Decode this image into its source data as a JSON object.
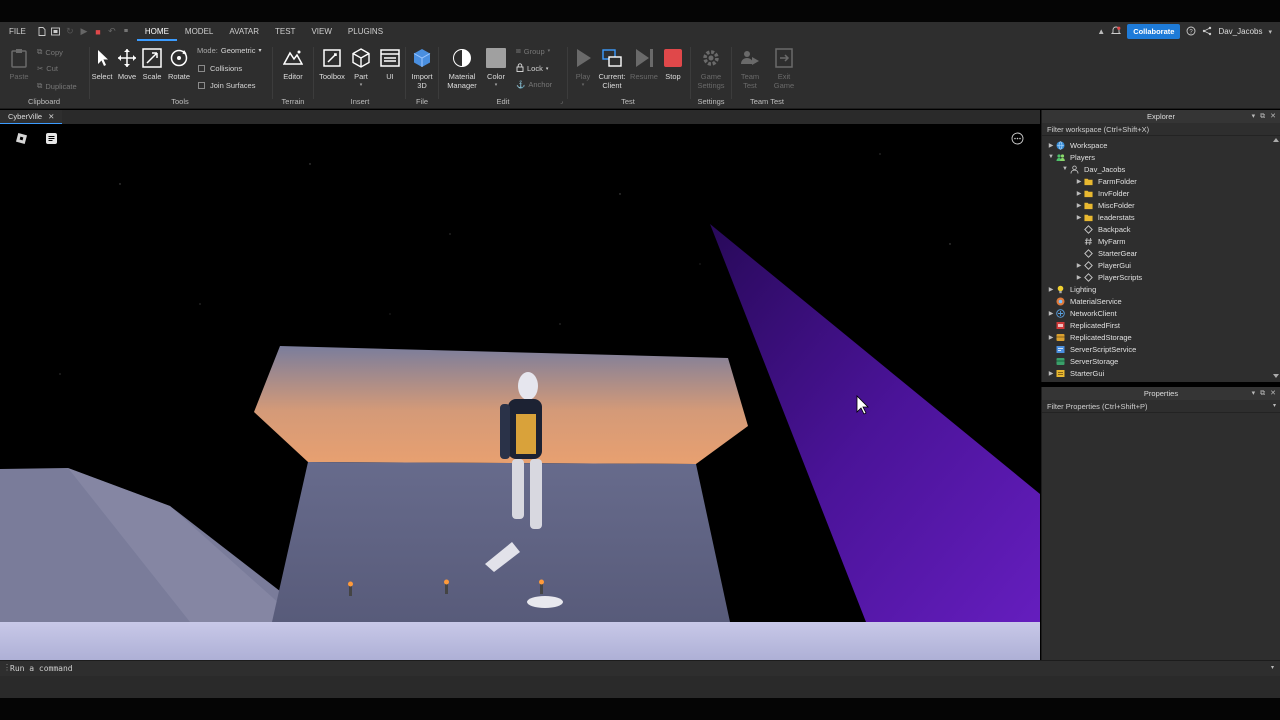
{
  "menubar": {
    "file": "FILE",
    "tabs": [
      "HOME",
      "MODEL",
      "AVATAR",
      "TEST",
      "VIEW",
      "PLUGINS"
    ],
    "collaborate": "Collaborate",
    "user": "Dav_Jacobs"
  },
  "ribbon": {
    "clipboard": {
      "label": "Clipboard",
      "paste": "Paste",
      "copy": "Copy",
      "cut": "Cut",
      "duplicate": "Duplicate"
    },
    "tools": {
      "label": "Tools",
      "select": "Select",
      "move": "Move",
      "scale": "Scale",
      "rotate": "Rotate",
      "mode_label": "Mode:",
      "mode_value": "Geometric",
      "collisions": "Collisions",
      "join_surfaces": "Join Surfaces"
    },
    "terrain": {
      "label": "Terrain",
      "editor": "Editor"
    },
    "insert": {
      "label": "Insert",
      "toolbox": "Toolbox",
      "part": "Part",
      "ui": "UI"
    },
    "file": {
      "label": "File",
      "import3d_line1": "Import",
      "import3d_line2": "3D"
    },
    "edit": {
      "label": "Edit",
      "material_line1": "Material",
      "material_line2": "Manager",
      "color": "Color",
      "group": "Group",
      "lock": "Lock",
      "anchor": "Anchor"
    },
    "test": {
      "label": "Test",
      "play": "Play",
      "current_line1": "Current:",
      "current_line2": "Client",
      "resume": "Resume",
      "stop": "Stop"
    },
    "settings": {
      "label": "Settings",
      "game_line1": "Game",
      "game_line2": "Settings"
    },
    "teamtest": {
      "label": "Team Test",
      "team_line1": "Team",
      "team_line2": "Test",
      "exit_line1": "Exit",
      "exit_line2": "Game"
    }
  },
  "tab": {
    "name": "CyberVille"
  },
  "command": {
    "placeholder": "Run a command"
  },
  "explorer": {
    "title": "Explorer",
    "filter": "Filter workspace (Ctrl+Shift+X)",
    "items": [
      {
        "label": "Workspace",
        "indent": 0,
        "arrow": "right",
        "icon": "globe-icon"
      },
      {
        "label": "Players",
        "indent": 0,
        "arrow": "down",
        "icon": "players-icon"
      },
      {
        "label": "Dav_Jacobs",
        "indent": 1,
        "arrow": "down",
        "icon": "player-icon"
      },
      {
        "label": "FarmFolder",
        "indent": 2,
        "arrow": "right",
        "icon": "folder-icon"
      },
      {
        "label": "InvFolder",
        "indent": 2,
        "arrow": "right",
        "icon": "folder-icon"
      },
      {
        "label": "MiscFolder",
        "indent": 2,
        "arrow": "right",
        "icon": "folder-icon"
      },
      {
        "label": "leaderstats",
        "indent": 2,
        "arrow": "right",
        "icon": "folder-icon"
      },
      {
        "label": "Backpack",
        "indent": 2,
        "arrow": "none",
        "icon": "diamond-icon"
      },
      {
        "label": "MyFarm",
        "indent": 2,
        "arrow": "none",
        "icon": "hash-icon"
      },
      {
        "label": "StarterGear",
        "indent": 2,
        "arrow": "none",
        "icon": "diamond-icon"
      },
      {
        "label": "PlayerGui",
        "indent": 2,
        "arrow": "right",
        "icon": "diamond-icon"
      },
      {
        "label": "PlayerScripts",
        "indent": 2,
        "arrow": "right",
        "icon": "diamond-icon"
      },
      {
        "label": "Lighting",
        "indent": 0,
        "arrow": "right",
        "icon": "bulb-icon"
      },
      {
        "label": "MaterialService",
        "indent": 0,
        "arrow": "none",
        "icon": "material-icon"
      },
      {
        "label": "NetworkClient",
        "indent": 0,
        "arrow": "right",
        "icon": "network-icon"
      },
      {
        "label": "ReplicatedFirst",
        "indent": 0,
        "arrow": "none",
        "icon": "replicated-icon"
      },
      {
        "label": "ReplicatedStorage",
        "indent": 0,
        "arrow": "right",
        "icon": "storage-icon"
      },
      {
        "label": "ServerScriptService",
        "indent": 0,
        "arrow": "none",
        "icon": "script-service-icon"
      },
      {
        "label": "ServerStorage",
        "indent": 0,
        "arrow": "none",
        "icon": "server-storage-icon"
      },
      {
        "label": "StarterGui",
        "indent": 0,
        "arrow": "right",
        "icon": "starter-gui-icon"
      }
    ]
  },
  "properties": {
    "title": "Properties",
    "filter": "Filter Properties (Ctrl+Shift+P)"
  },
  "colors": {
    "accent": "#3c9cff",
    "stop": "#e0484a",
    "collaborate": "#1e7bd8",
    "beam": "#5b17b0"
  }
}
